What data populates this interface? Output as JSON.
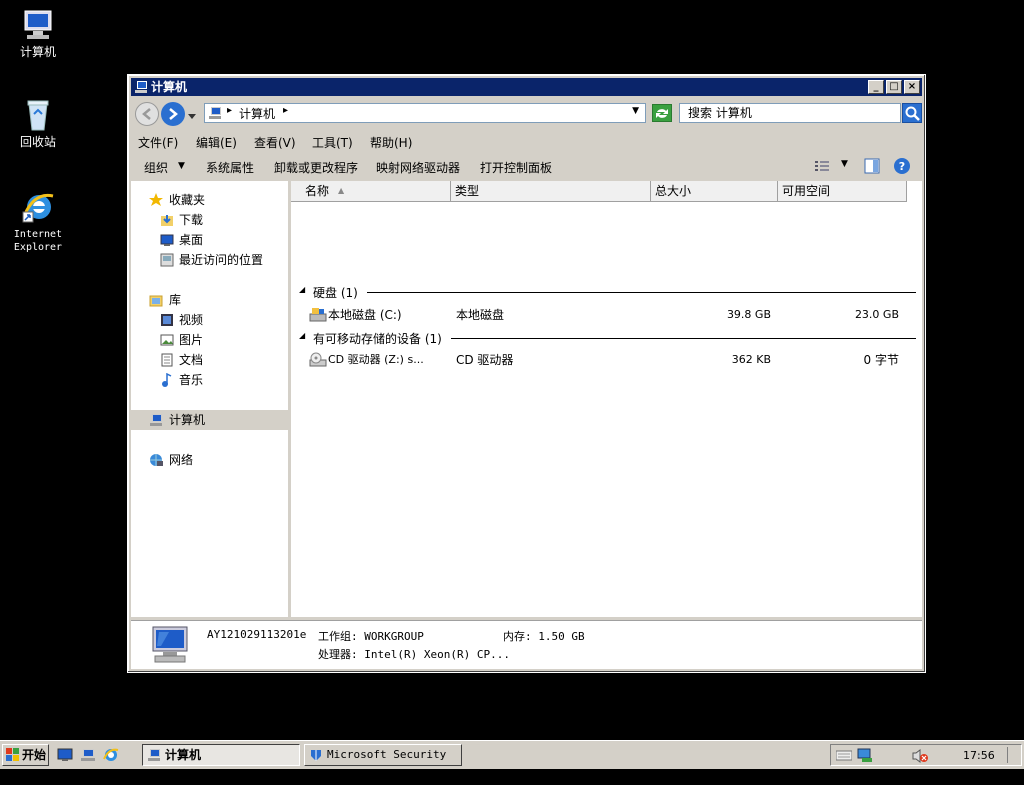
{
  "desktop": {
    "icons": [
      {
        "label": "计算机"
      },
      {
        "label": "回收站"
      },
      {
        "label": "Internet\nExplorer"
      }
    ]
  },
  "window": {
    "title": "计算机",
    "address": {
      "segment": "计算机"
    },
    "search": {
      "placeholder": "搜索 计算机"
    },
    "menu": [
      "文件(F)",
      "编辑(E)",
      "查看(V)",
      "工具(T)",
      "帮助(H)"
    ],
    "commands": [
      "组织",
      "系统属性",
      "卸载或更改程序",
      "映射网络驱动器",
      "打开控制面板"
    ],
    "nav": {
      "favorites": "收藏夹",
      "favorites_items": [
        "下载",
        "桌面",
        "最近访问的位置"
      ],
      "libraries": "库",
      "libraries_items": [
        "视频",
        "图片",
        "文档",
        "音乐"
      ],
      "computer": "计算机",
      "network": "网络"
    },
    "columns": [
      "名称",
      "类型",
      "总大小",
      "可用空间"
    ],
    "groups": [
      {
        "title": "硬盘 (1)",
        "items": [
          {
            "name": "本地磁盘 (C:)",
            "type": "本地磁盘",
            "total": "39.8 GB",
            "free": "23.0 GB"
          }
        ]
      },
      {
        "title": "有可移动存储的设备 (1)",
        "items": [
          {
            "name": "CD 驱动器 (Z:) s...",
            "type": "CD 驱动器",
            "total": "362 KB",
            "free": "0 字节"
          }
        ]
      }
    ],
    "details": {
      "computer_name": "AY121029113201e",
      "workgroup": "工作组: WORKGROUP",
      "memory": "内存: 1.50 GB",
      "processor": "处理器: Intel(R) Xeon(R) CP..."
    }
  },
  "taskbar": {
    "start": "开始",
    "buttons": [
      "计算机",
      "Microsoft Security ..."
    ],
    "clock": "17:56"
  },
  "colors": {
    "titlebar": "#0a246a",
    "desktop": "#000000",
    "chrome": "#d4d0c8"
  }
}
